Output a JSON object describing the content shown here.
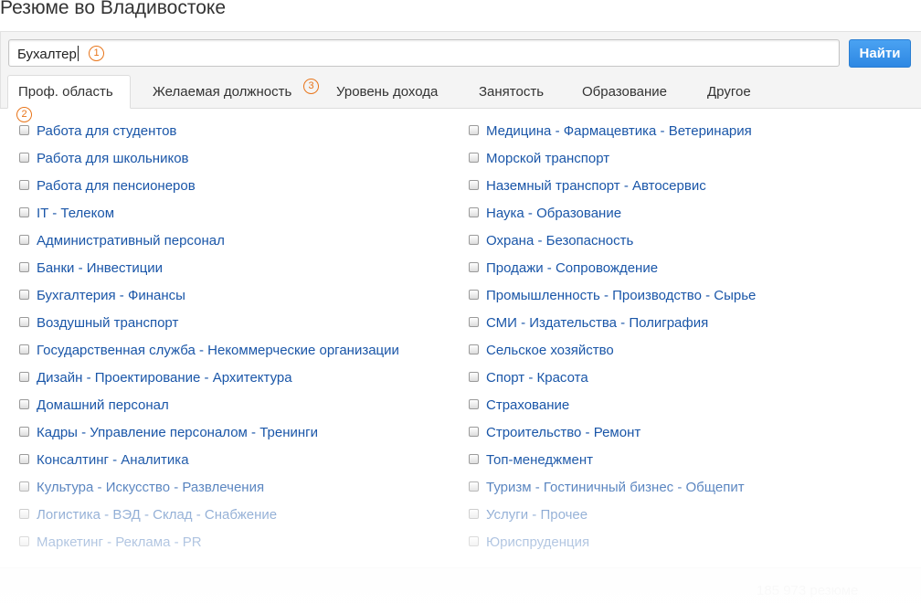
{
  "page": {
    "title": "Резюме во Владивостоке"
  },
  "search": {
    "value": "Бухалтер",
    "button_label": "Найти"
  },
  "markers": [
    "1",
    "2",
    "3"
  ],
  "tabs": [
    {
      "label": "Проф. область",
      "active": true
    },
    {
      "label": "Желаемая должность",
      "active": false
    },
    {
      "label": "Уровень дохода",
      "active": false
    },
    {
      "label": "Занятость",
      "active": false
    },
    {
      "label": "Образование",
      "active": false
    },
    {
      "label": "Другое",
      "active": false
    }
  ],
  "categories": {
    "left": [
      "Работа для студентов",
      "Работа для школьников",
      "Работа для пенсионеров",
      "IT - Телеком",
      "Административный персонал",
      "Банки - Инвестиции",
      "Бухгалтерия - Финансы",
      "Воздушный транспорт",
      "Государственная служба - Некоммерческие организации",
      "Дизайн - Проектирование - Архитектура",
      "Домашний персонал",
      "Кадры - Управление персоналом - Тренинги",
      "Консалтинг - Аналитика",
      "Культура - Искусство - Развлечения",
      "Логистика - ВЭД - Склад - Снабжение",
      "Маркетинг - Реклама - PR"
    ],
    "right": [
      "Медицина - Фармацевтика - Ветеринария",
      "Морской транспорт",
      "Наземный транспорт - Автосервис",
      "Наука - Образование",
      "Охрана - Безопасность",
      "Продажи - Сопровождение",
      "Промышленность - Производство - Сырье",
      "СМИ - Издательства - Полиграфия",
      "Сельское хозяйство",
      "Спорт - Красота",
      "Страхование",
      "Строительство - Ремонт",
      "Топ-менеджмент",
      "Туризм - Гостиничный бизнес - Общепит",
      "Услуги - Прочее",
      "Юриспруденция"
    ]
  },
  "footer": {
    "count_text": "185 973 резюме"
  },
  "colors": {
    "link": "#1a56a8",
    "button": "#2e88e3",
    "marker": "#e8751a"
  }
}
